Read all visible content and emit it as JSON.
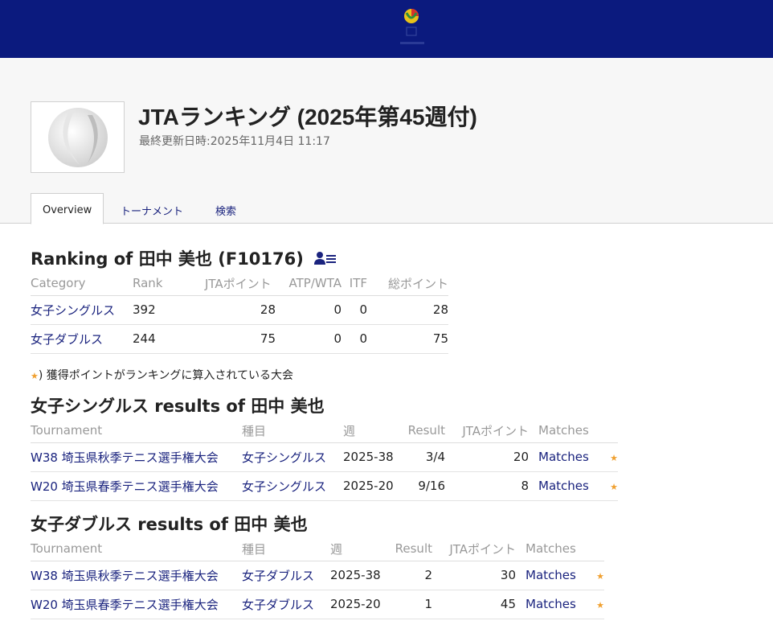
{
  "header": {
    "brand_color": "#0b1a7e",
    "logo_icon": "tennis-logo-icon"
  },
  "hero": {
    "title": "JTAランキング (2025年第45週付)",
    "updated": "最終更新日時:2025年11月4日 11:17"
  },
  "tabs": [
    {
      "label": "Overview",
      "active": true
    },
    {
      "label": "トーナメント"
    },
    {
      "label": "検索"
    }
  ],
  "ranking": {
    "heading": "Ranking of 田中 美也 (F10176)",
    "columns": [
      "Category",
      "Rank",
      "JTAポイント",
      "ATP/WTA",
      "ITF",
      "総ポイント"
    ],
    "rows": [
      [
        "女子シングルス",
        "392",
        "28",
        "0",
        "0",
        "28"
      ],
      [
        "女子ダブルス",
        "244",
        "75",
        "0",
        "0",
        "75"
      ]
    ]
  },
  "note": {
    "star": "★",
    "text": ") 獲得ポイントがランキングに算入されている大会"
  },
  "singles": {
    "heading": "女子シングルス results of 田中 美也",
    "columns": [
      "Tournament",
      "種目",
      "週",
      "Result",
      "JTAポイント",
      "Matches"
    ],
    "rows": [
      [
        "W38 埼玉県秋季テニス選手権大会",
        "女子シングルス",
        "2025-38",
        "3/4",
        "20",
        "Matches"
      ],
      [
        "W20 埼玉県春季テニス選手権大会",
        "女子シングルス",
        "2025-20",
        "9/16",
        "8",
        "Matches"
      ]
    ]
  },
  "doubles": {
    "heading": "女子ダブルス results of 田中 美也",
    "columns": [
      "Tournament",
      "種目",
      "週",
      "Result",
      "JTAポイント",
      "Matches"
    ],
    "rows": [
      [
        "W38 埼玉県秋季テニス選手権大会",
        "女子ダブルス",
        "2025-38",
        "2",
        "30",
        "Matches"
      ],
      [
        "W20 埼玉県春季テニス選手権大会",
        "女子ダブルス",
        "2025-20",
        "1",
        "45",
        "Matches"
      ]
    ]
  }
}
